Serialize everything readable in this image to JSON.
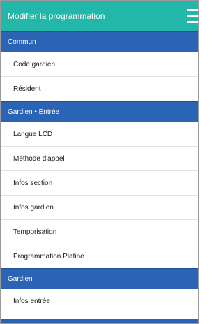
{
  "appbar": {
    "title": "Modifier la programmation",
    "menu_icon": "hamburger-menu-icon",
    "color": "#22b7a8"
  },
  "sections": [
    {
      "label": "Commun",
      "items": [
        "Code gardien",
        "Résident"
      ]
    },
    {
      "label": "Gardien • Entrée",
      "items": [
        "Langue LCD",
        "Méthode d'appel",
        "Infos section",
        "Infos gardien",
        "Temporisation",
        "Programmation Platine"
      ]
    },
    {
      "label": "Gardien",
      "items": [
        "Infos entrée"
      ]
    }
  ],
  "colors": {
    "section_header": "#2b63b5",
    "appbar": "#22b7a8"
  }
}
